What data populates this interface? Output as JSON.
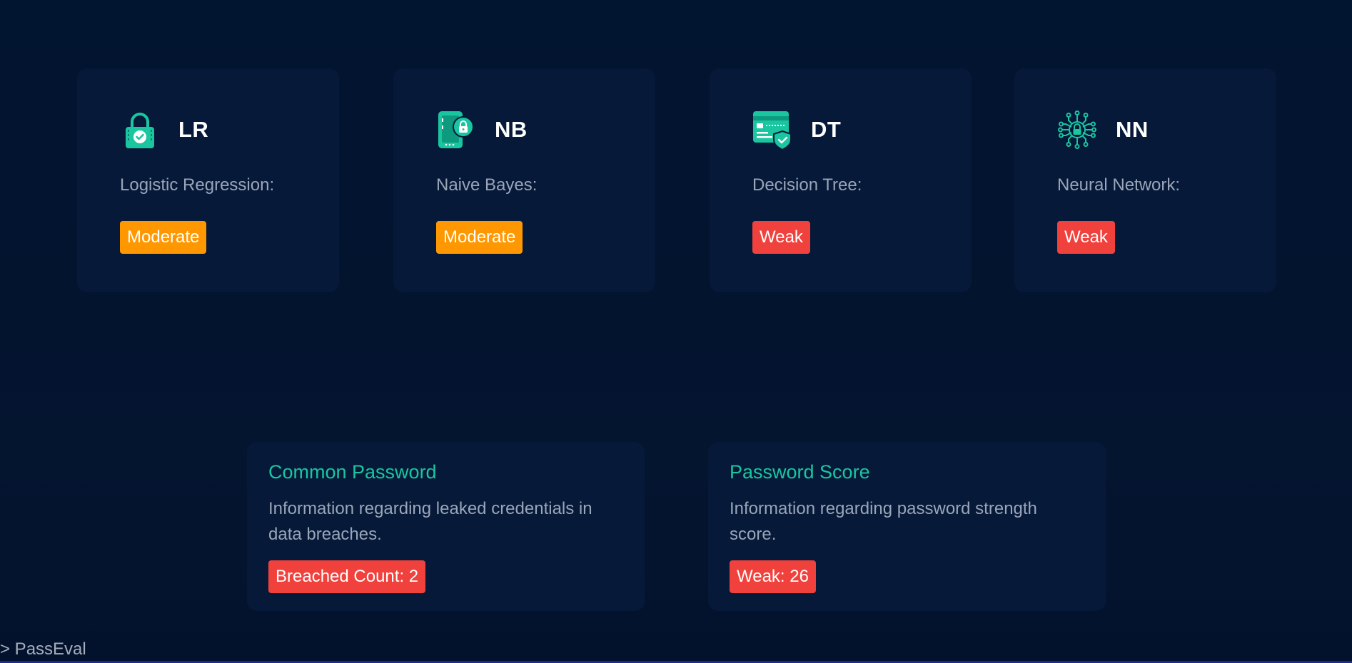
{
  "colors": {
    "accent": "#19c6a0",
    "moderate": "#ff9800",
    "weak": "#f0413c",
    "card_bg": "#061939",
    "page_bg": "#031530",
    "muted_text": "#9aa5b8"
  },
  "models": [
    {
      "abbr": "LR",
      "name": "Logistic Regression:",
      "icon": "padlock-check-icon",
      "status": "Moderate",
      "status_color": "#ff9800"
    },
    {
      "abbr": "NB",
      "name": "Naive Bayes:",
      "icon": "phone-lock-icon",
      "status": "Moderate",
      "status_color": "#ff9800"
    },
    {
      "abbr": "DT",
      "name": "Decision Tree:",
      "icon": "credit-card-shield-icon",
      "status": "Weak",
      "status_color": "#f0413c"
    },
    {
      "abbr": "NN",
      "name": "Neural Network:",
      "icon": "circuit-lock-icon",
      "status": "Weak",
      "status_color": "#f0413c"
    }
  ],
  "common_password": {
    "title": "Common Password",
    "description": "Information regarding leaked credentials in data breaches.",
    "badge": "Breached Count: 2"
  },
  "password_score": {
    "title": "Password Score",
    "description": "Information regarding password strength score.",
    "badge": "Weak: 26"
  },
  "footer": {
    "brand": "> PassEval"
  }
}
